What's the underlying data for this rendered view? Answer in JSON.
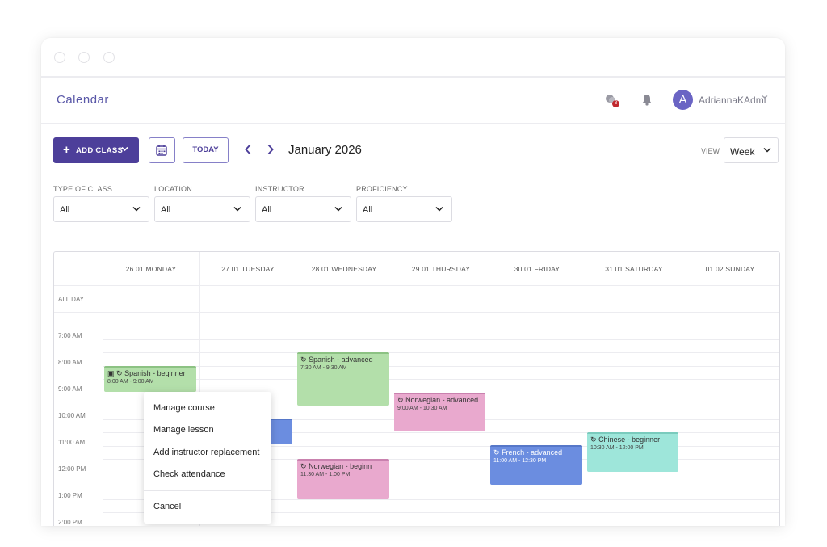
{
  "app": {
    "title": "Calendar",
    "notification_count": "3",
    "user_initial": "A",
    "username": "AdriannaKAdmi"
  },
  "toolbar": {
    "add_class_label": "ADD CLASS",
    "today_label": "TODAY",
    "month_label": "January 2026",
    "view_label": "VIEW",
    "view_value": "Week"
  },
  "filters": [
    {
      "label": "TYPE OF CLASS",
      "value": "All"
    },
    {
      "label": "LOCATION",
      "value": "All"
    },
    {
      "label": "INSTRUCTOR",
      "value": "All"
    },
    {
      "label": "PROFICIENCY",
      "value": "All"
    }
  ],
  "calendar": {
    "days": [
      "26.01 MONDAY",
      "27.01 TUESDAY",
      "28.01 WEDNESDAY",
      "29.01 THURSDAY",
      "30.01 FRIDAY",
      "31.01 SATURDAY",
      "01.02 SUNDAY"
    ],
    "all_day_label": "ALL DAY",
    "times": [
      "7:00 AM",
      "8:00 AM",
      "9:00 AM",
      "10:00 AM",
      "11:00 AM",
      "12:00 PM",
      "1:00 PM",
      "2:00 PM"
    ],
    "events": [
      {
        "title": "Spanish - beginner",
        "time": "8:00 AM - 9:00 AM",
        "color": "#b3dfaa"
      },
      {
        "title": "Spanish - advanced",
        "time": "7:30 AM - 9:30 AM",
        "color": "#b3dfaa"
      },
      {
        "title": "Norwegian - beginn",
        "time": "11:30 AM - 1:00 PM",
        "color": "#e9a9ce"
      },
      {
        "title": "Norwegian - advanced",
        "time": "9:00 AM - 10:30 AM",
        "color": "#e9a9ce"
      },
      {
        "title": "French - advanced",
        "time": "11:00 AM - 12:30 PM",
        "color": "#6b8de0"
      },
      {
        "title": "Chinese - beginner",
        "time": "10:30 AM - 12:00 PM",
        "color": "#9ee6da"
      }
    ]
  },
  "context_menu": {
    "items": [
      "Manage course",
      "Manage lesson",
      "Add instructor replacement",
      "Check attendance"
    ],
    "cancel": "Cancel"
  },
  "colors": {
    "accent": "#4d3f9a",
    "outline": "#8680c8",
    "title": "#5a58a8",
    "badge": "#c0282e"
  }
}
